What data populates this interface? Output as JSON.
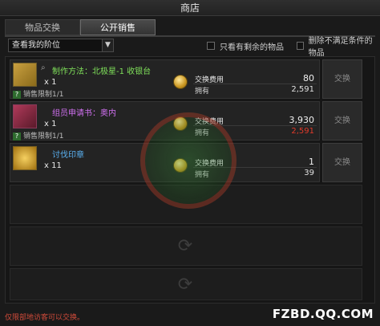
{
  "window": {
    "title": "商店"
  },
  "tabs": [
    {
      "label": "物品交换",
      "active": false
    },
    {
      "label": "公开销售",
      "active": true
    }
  ],
  "filters": {
    "select_value": "查看我的阶位",
    "only_remaining": "只看有剩余的物品",
    "hide_unmet": "删除不满足条件的物品"
  },
  "items": [
    {
      "name": "制作方法：北极星-1 收银台",
      "name_color": "#7fe05a",
      "qty": "x 1",
      "limit": "销售限制1/1",
      "cost_label": "交换费用",
      "cost_value": "80",
      "have_label": "拥有",
      "have_value": "2,591",
      "have_short": false,
      "button": "交换",
      "icon": "recipe-scroll-icon"
    },
    {
      "name": "组员申请书：奥内",
      "name_color": "#d070f0",
      "qty": "x 1",
      "limit": "销售限制1/1",
      "cost_label": "交换费用",
      "cost_value": "3,930",
      "have_label": "拥有",
      "have_value": "2,591",
      "have_short": true,
      "button": "交换",
      "icon": "crew-application-book-icon"
    },
    {
      "name": "讨伐印章",
      "name_color": "#5ab0f0",
      "qty": "x 11",
      "limit": "",
      "cost_label": "交换费用",
      "cost_value": "1",
      "have_label": "拥有",
      "have_value": "39",
      "have_short": false,
      "button": "交换",
      "icon": "subjugation-seal-icon"
    }
  ],
  "footer": {
    "notice": "仅限部地访客可以交换。"
  },
  "watermark": {
    "site": "FZBD.QQ.COM"
  },
  "colors": {
    "short": "#e23a2a",
    "accent": "#c9951f"
  }
}
